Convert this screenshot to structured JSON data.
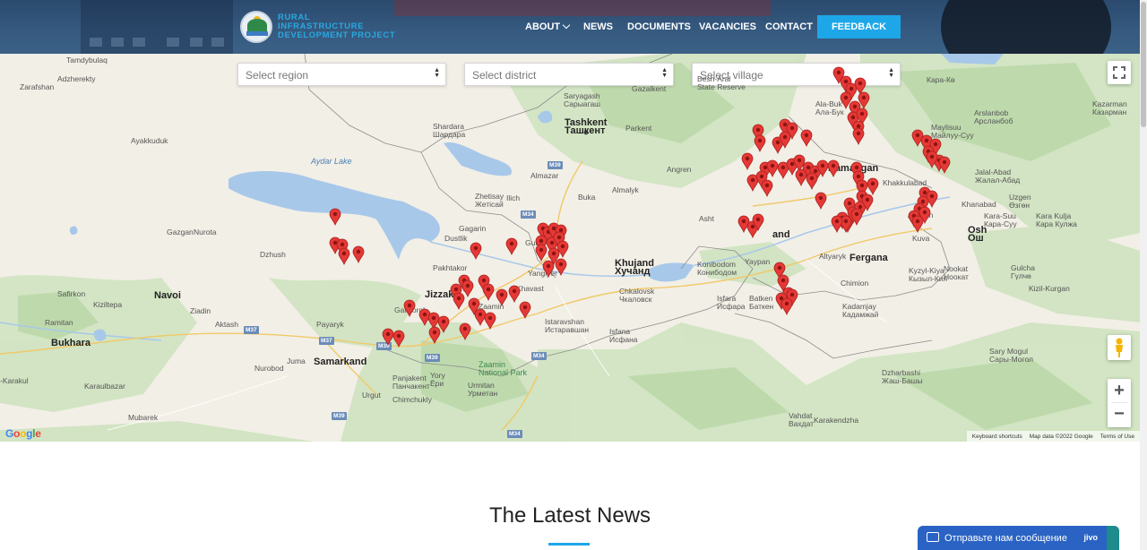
{
  "header": {
    "logo_lines": [
      "Rural",
      "Infrastructure",
      "Development Project"
    ],
    "nav": [
      {
        "label": "ABOUT",
        "has_dropdown": true
      },
      {
        "label": "NEWS"
      },
      {
        "label": "DOCUMENTS"
      },
      {
        "label": "VACANCIES"
      },
      {
        "label": "CONTACT"
      }
    ],
    "feedback_label": "FEEDBACK"
  },
  "map": {
    "selects": {
      "region": "Select region",
      "district": "Select district",
      "village": "Select village"
    },
    "labels": {
      "tamdybulaq": "Tamdybulaq",
      "adzherekty": "Adzherekty",
      "zarafshan": "Zarafshan",
      "ayakkuduk": "Ayakkuduk",
      "aydar_lake": "Aydar Lake",
      "gazgan": "Gazgan",
      "nurota": "Nurota",
      "dzhush": "Dzhush",
      "safirkon": "Safirkon",
      "navoi": "Navoi",
      "kiziltepa": "Kiziltepa",
      "ramitan": "Ramitan",
      "ziadin": "Ziadin",
      "aktash": "Aktash",
      "payaryk": "Payaryk",
      "bukhara": "Bukhara",
      "juma": "Juma",
      "samarkand": "Samarkand",
      "nurobod": "Nurobod",
      "karakul": "-Karakul",
      "karaulbazar": "Karaulbazar",
      "mubarek": "Mubarek",
      "urgut": "Urgut",
      "panjakent": "Panjakent\nПанчакент",
      "chimchukly": "Chimchukly",
      "gallaorol": "Gallaorol",
      "jizzakh": "Jizzakh",
      "pakhtakor": "Pakhtakor",
      "dustlik": "Dustlik",
      "gagarin": "Gagarin",
      "zhetisay": "Zhetisay\nЖетісай",
      "ilich": "Ilich",
      "gulistan": "Gulis",
      "yangiyer": "Yangiyer",
      "khavast": "Khavast",
      "zaamin": "Zaamin",
      "zaamin_park": "Zaamin\nNational Park",
      "urmitan": "Urmitan\nУрметан",
      "yory": "Yory\nЁри",
      "istaravshan": "Istaravshan\nИстаравшан",
      "isfana": "Isfana\nИсфана",
      "shardara": "Shardara\nШардара",
      "saryagash": "Saryagash\nСарыагаш",
      "tashkent": "Tashkent\nТашкент",
      "gazalkent": "Gazalkent",
      "parkent": "Parkent",
      "almazar": "Almazar",
      "buka": "Buka",
      "almalyk": "Almalyk",
      "angren": "Angren",
      "asht": "Asht",
      "khujand": "Khujand\nХучанд",
      "konibodom": "Konibodom\nКонибодом",
      "chkalovsk": "Chkalovsk\nЧкаловск",
      "isfara": "Isfara\nИсфара",
      "batken": "Batken\nБаткен",
      "kokand": "and",
      "yaypan": "Yaypan",
      "altyaryk": "Altyaryk",
      "fergana": "Fergana",
      "chimion": "Chimion",
      "kadamjay": "Kadamjay\nКадамжай",
      "kuva": "Kuva",
      "andijan": "Andijan",
      "khakkulabad": "Khakkulabad",
      "namangan": "Namangan",
      "besh_aral": "Besh-Aral\nState Reserve",
      "ala_buka": "Ala-Buk\nАла-Бук",
      "kara_ke": "Кара-Кө",
      "maylisuu": "Maylisuu\nМайлуу-Суу",
      "arslanbob": "Arslanbob\nАрсланбоб",
      "kazarman": "Kazarman\nКазарман",
      "jalal_abad": "Jalal-Abad\nЖалал-Абад",
      "khanabad": "Khanabad",
      "uzgen": "Uzgen\nӨзгөн",
      "kara_suu": "Kara-Suu\nКара-Суу",
      "kara_kulja": "Kara Kulja\nКара Кулжа",
      "osh": "Osh\nОш",
      "kyzyl_kiya": "Kyzyl-Kiya\nКызыл-Кия",
      "nookat": "Nookat\nНоокат",
      "gulcha": "Gulcha\nГүлчө",
      "kizil_kurgan": "Kizil-Kurgan",
      "sary_mogul": "Sary Mogul\nСары-Могол",
      "dzharbashi": "Dzharbashi\nЖаш-Башы",
      "vahdat": "Vahdat\nВахдат",
      "karakendzha": "Karakendzha"
    },
    "road_labels": [
      "M39",
      "M34",
      "M37",
      "M37",
      "M39",
      "M39",
      "M34",
      "M34",
      "M39"
    ],
    "pin_count": 130,
    "attribution": {
      "shortcuts": "Keyboard shortcuts",
      "map_data": "Map data ©2022 Google",
      "terms": "Terms of Use"
    },
    "google_logo": "Google",
    "zoom_in": "+",
    "zoom_out": "−"
  },
  "news": {
    "title": "The Latest News"
  },
  "chat": {
    "label": "Отправьте нам сообщение",
    "brand": "jivo"
  },
  "colors": {
    "accent": "#1ea7e8",
    "header_bg": "#35597f",
    "pin": "#e53935",
    "chat": "#2a63c3"
  }
}
